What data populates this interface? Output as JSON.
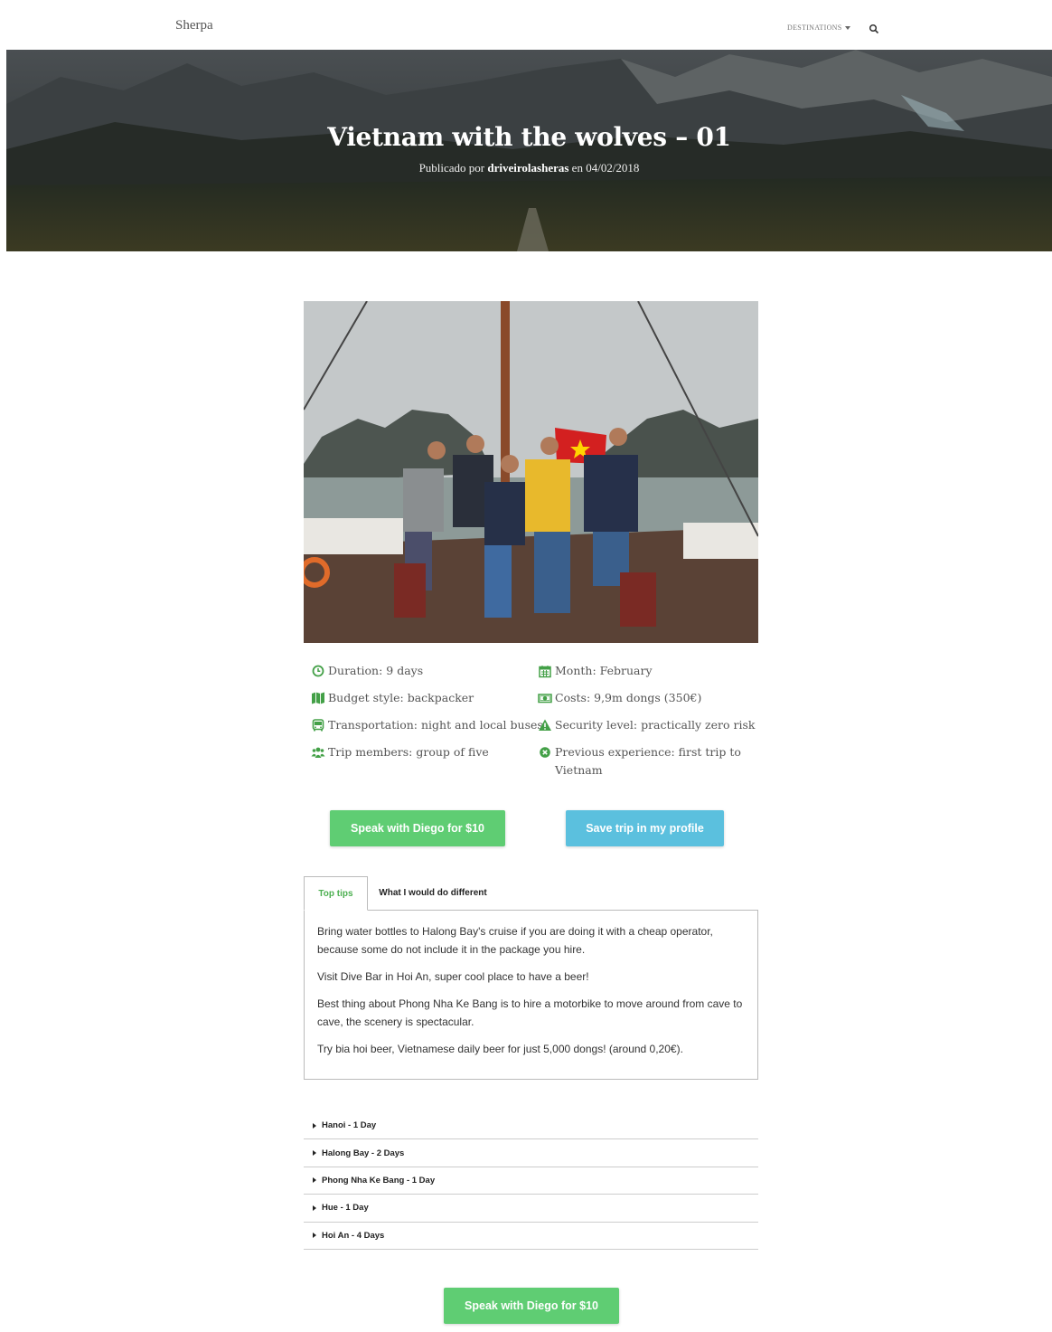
{
  "nav": {
    "brand": "Sherpa",
    "destinations_label": "DESTINATIONS",
    "search_icon": "search-icon"
  },
  "hero": {
    "title": "Vietnam with the wolves – 01",
    "published_prefix": "Publicado por",
    "author": "driveirolasheras",
    "date_prefix": "en",
    "date": "04/02/2018"
  },
  "facts": {
    "duration": "Duration: 9 days",
    "month": "Month: February",
    "budget": "Budget style: backpacker",
    "costs": "Costs: 9,9m dongs (350€)",
    "transportation": "Transportation: night and local buses",
    "security": "Security level: practically zero risk",
    "members": "Trip members: group of five",
    "experience_line1": "Previous experience: first trip to",
    "experience_line2": "Vietnam"
  },
  "buttons": {
    "speak": "Speak with Diego for $10",
    "save": "Save trip in my profile",
    "speak_bottom": "Speak with Diego for $10"
  },
  "tabs": {
    "items": [
      "Top tips",
      "What I would do different"
    ],
    "active": "Top tips",
    "tips": [
      "Bring water bottles to Halong Bay's cruise if you are doing it with a cheap operator, because some do not include it in the package you hire.",
      "Visit Dive Bar in Hoi An, super cool place to have a beer!",
      "Best thing about Phong Nha Ke Bang is to hire a motorbike to move around from cave to cave, the scenery is spectacular.",
      "Try bia hoi beer, Vietnamese daily beer for just 5,000 dongs! (around 0,20€)."
    ]
  },
  "itinerary": [
    "Hanoi - 1 Day",
    "Halong Bay - 2 Days",
    "Phong Nha Ke Bang - 1 Day",
    "Hue - 1 Day",
    "Hoi An - 4 Days"
  ],
  "colors": {
    "green": "#5fcd73",
    "blue": "#5bc0de",
    "icon_green": "#43a047"
  }
}
